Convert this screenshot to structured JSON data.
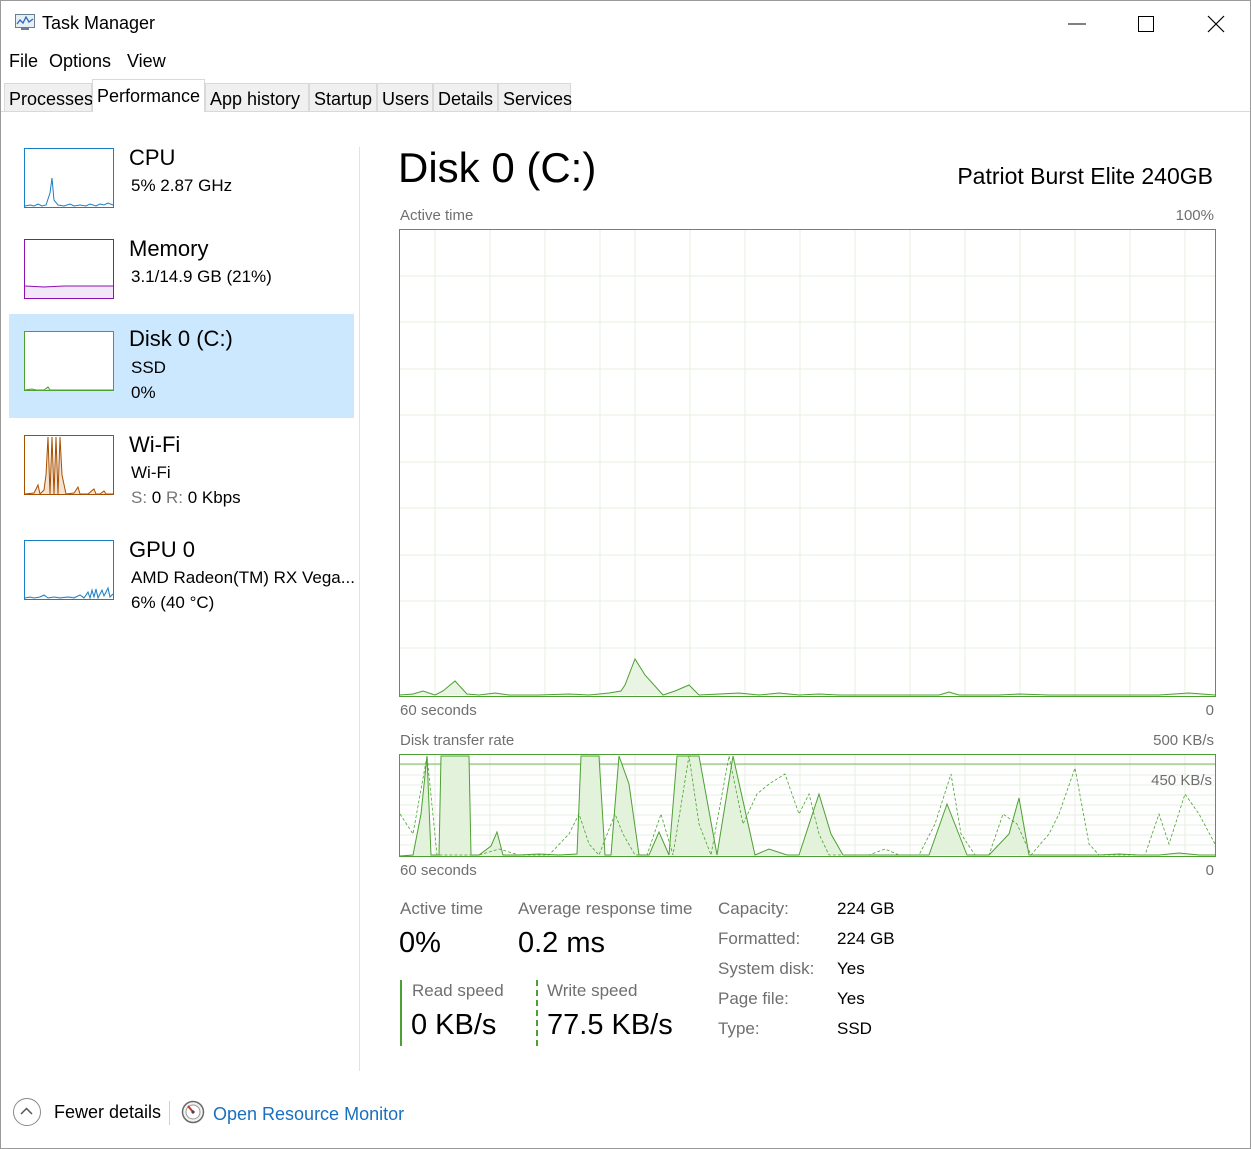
{
  "window": {
    "title": "Task Manager"
  },
  "menu": [
    "File",
    "Options",
    "View"
  ],
  "tabs": [
    "Processes",
    "Performance",
    "App history",
    "Startup",
    "Users",
    "Details",
    "Services"
  ],
  "active_tab": "Performance",
  "sidebar": {
    "cpu": {
      "title": "CPU",
      "line1": "5%  2.87 GHz",
      "color": "#1a7fc4"
    },
    "memory": {
      "title": "Memory",
      "line1": "3.1/14.9 GB (21%)",
      "color": "#8b12ae"
    },
    "disk": {
      "title": "Disk 0 (C:)",
      "line1": "SSD",
      "line2": "0%",
      "color": "#4da033"
    },
    "wifi": {
      "title": "Wi-Fi",
      "line1": "Wi-Fi",
      "s_label": "S:",
      "s_value": "0",
      "r_label": "R:",
      "r_value": "0 Kbps",
      "color": "#a74f01"
    },
    "gpu": {
      "title": "GPU 0",
      "line1": "AMD Radeon(TM) RX Vega...",
      "line2": "6% (40 °C)",
      "color": "#1a7fc4"
    }
  },
  "main": {
    "title": "Disk 0 (C:)",
    "model": "Patriot Burst Elite 240GB",
    "active_chart": {
      "label": "Active time",
      "max": "100%",
      "xlabel": "60 seconds",
      "xmin": "0"
    },
    "transfer_chart": {
      "label": "Disk transfer rate",
      "max": "500 KB/s",
      "mark": "450 KB/s",
      "xlabel": "60 seconds",
      "xmin": "0"
    },
    "stats": {
      "active_time_label": "Active time",
      "active_time_value": "0%",
      "avg_resp_label": "Average response time",
      "avg_resp_value": "0.2 ms",
      "read_label": "Read speed",
      "read_value": "0 KB/s",
      "write_label": "Write speed",
      "write_value": "77.5 KB/s"
    },
    "properties": [
      {
        "label": "Capacity:",
        "value": "224 GB"
      },
      {
        "label": "Formatted:",
        "value": "224 GB"
      },
      {
        "label": "System disk:",
        "value": "Yes"
      },
      {
        "label": "Page file:",
        "value": "Yes"
      },
      {
        "label": "Type:",
        "value": "SSD"
      }
    ]
  },
  "footer": {
    "fewer_details": "Fewer details",
    "open_resmon": "Open Resource Monitor"
  }
}
